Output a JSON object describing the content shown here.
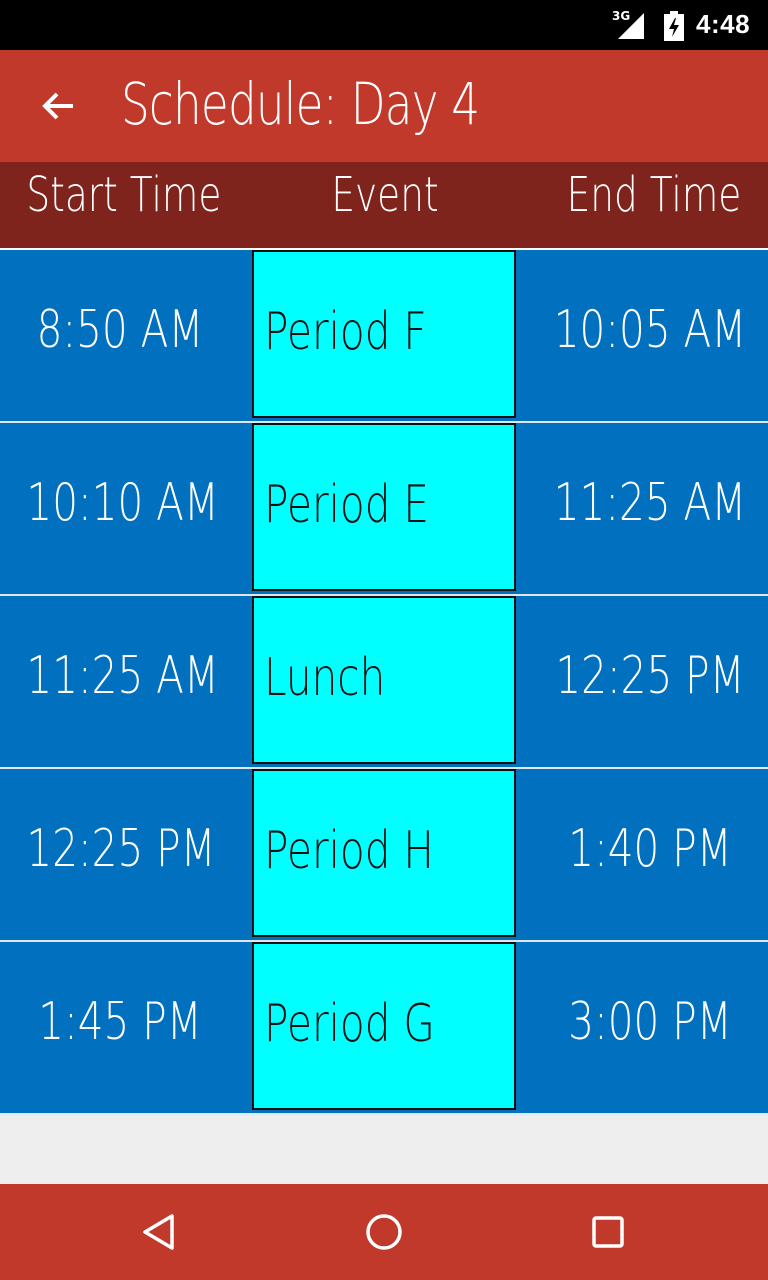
{
  "status_bar": {
    "network": "3G",
    "time": "4:48",
    "icons": [
      "signal-icon",
      "battery-charging-icon"
    ]
  },
  "app_bar": {
    "title": "Schedule: Day 4",
    "back_icon": "arrow-back-icon"
  },
  "table": {
    "headers": {
      "start": "Start Time",
      "event": "Event",
      "end": "End Time"
    },
    "rows": [
      {
        "start": "8:50 AM",
        "event": "Period F",
        "end": "10:05 AM"
      },
      {
        "start": "10:10 AM",
        "event": "Period E",
        "end": "11:25 AM"
      },
      {
        "start": "11:25 AM",
        "event": "Lunch",
        "end": "12:25 PM"
      },
      {
        "start": "12:25 PM",
        "event": "Period H",
        "end": "1:40 PM"
      },
      {
        "start": "1:45 PM",
        "event": "Period G",
        "end": "3:00 PM"
      }
    ]
  },
  "nav_bar": {
    "icons": [
      "nav-back-icon",
      "nav-home-icon",
      "nav-recents-icon"
    ]
  },
  "colors": {
    "app_bar": "#c0392b",
    "header_row": "#7f241d",
    "row_background": "#0170be",
    "event_cell": "#00ffff",
    "status_bar": "#000000",
    "page_background": "#eeeeee"
  }
}
